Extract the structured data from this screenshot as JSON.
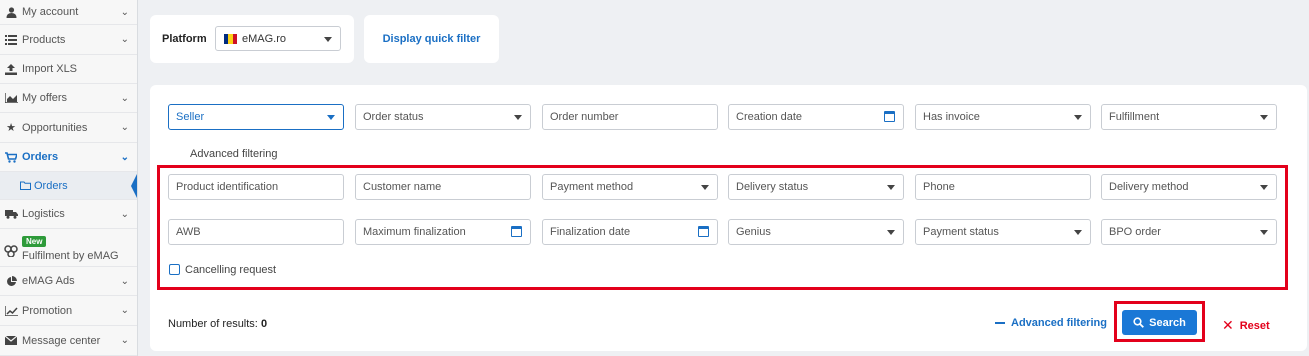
{
  "sidebar": {
    "items": [
      {
        "label": "My account",
        "icon": "user-icon"
      },
      {
        "label": "Products",
        "icon": "list-icon"
      },
      {
        "label": "Import XLS",
        "icon": "upload-icon"
      },
      {
        "label": "My offers",
        "icon": "chart-area-icon"
      },
      {
        "label": "Opportunities",
        "icon": "star-icon"
      },
      {
        "label": "Orders",
        "icon": "cart-icon"
      },
      {
        "label": "Orders",
        "icon": "folder-icon"
      },
      {
        "label": "Logistics",
        "icon": "truck-icon"
      },
      {
        "label": "Fulfilment by eMAG",
        "icon": "boxes-icon",
        "badge": "New"
      },
      {
        "label": "eMAG Ads",
        "icon": "pie-chart-icon"
      },
      {
        "label": "Promotion",
        "icon": "line-chart-icon"
      },
      {
        "label": "Message center",
        "icon": "envelope-icon"
      }
    ]
  },
  "platform": {
    "label": "Platform",
    "value": "eMAG.ro",
    "flag_colors": [
      "#002B7F",
      "#FCD116",
      "#CE1126"
    ]
  },
  "quick_filter": {
    "label": "Display quick filter"
  },
  "filters": {
    "row1": [
      "Seller",
      "Order status",
      "Order number",
      "Creation date",
      "Has invoice",
      "Fulfillment"
    ],
    "advanced_label": "Advanced filtering",
    "row2": [
      "Product identification",
      "Customer name",
      "Payment method",
      "Delivery status",
      "Phone",
      "Delivery method"
    ],
    "row3": [
      "AWB",
      "Maximum finalization",
      "Finalization date",
      "Genius",
      "Payment status",
      "BPO order"
    ],
    "cancelling_request": "Cancelling request"
  },
  "footer": {
    "results_label": "Number of results:",
    "results_count": "0",
    "advanced_link": "Advanced filtering",
    "search_label": "Search",
    "reset_label": "Reset"
  },
  "colors": {
    "accent": "#1a78d6",
    "highlight": "#e3001b",
    "active_nav": "#1a6fc4"
  }
}
